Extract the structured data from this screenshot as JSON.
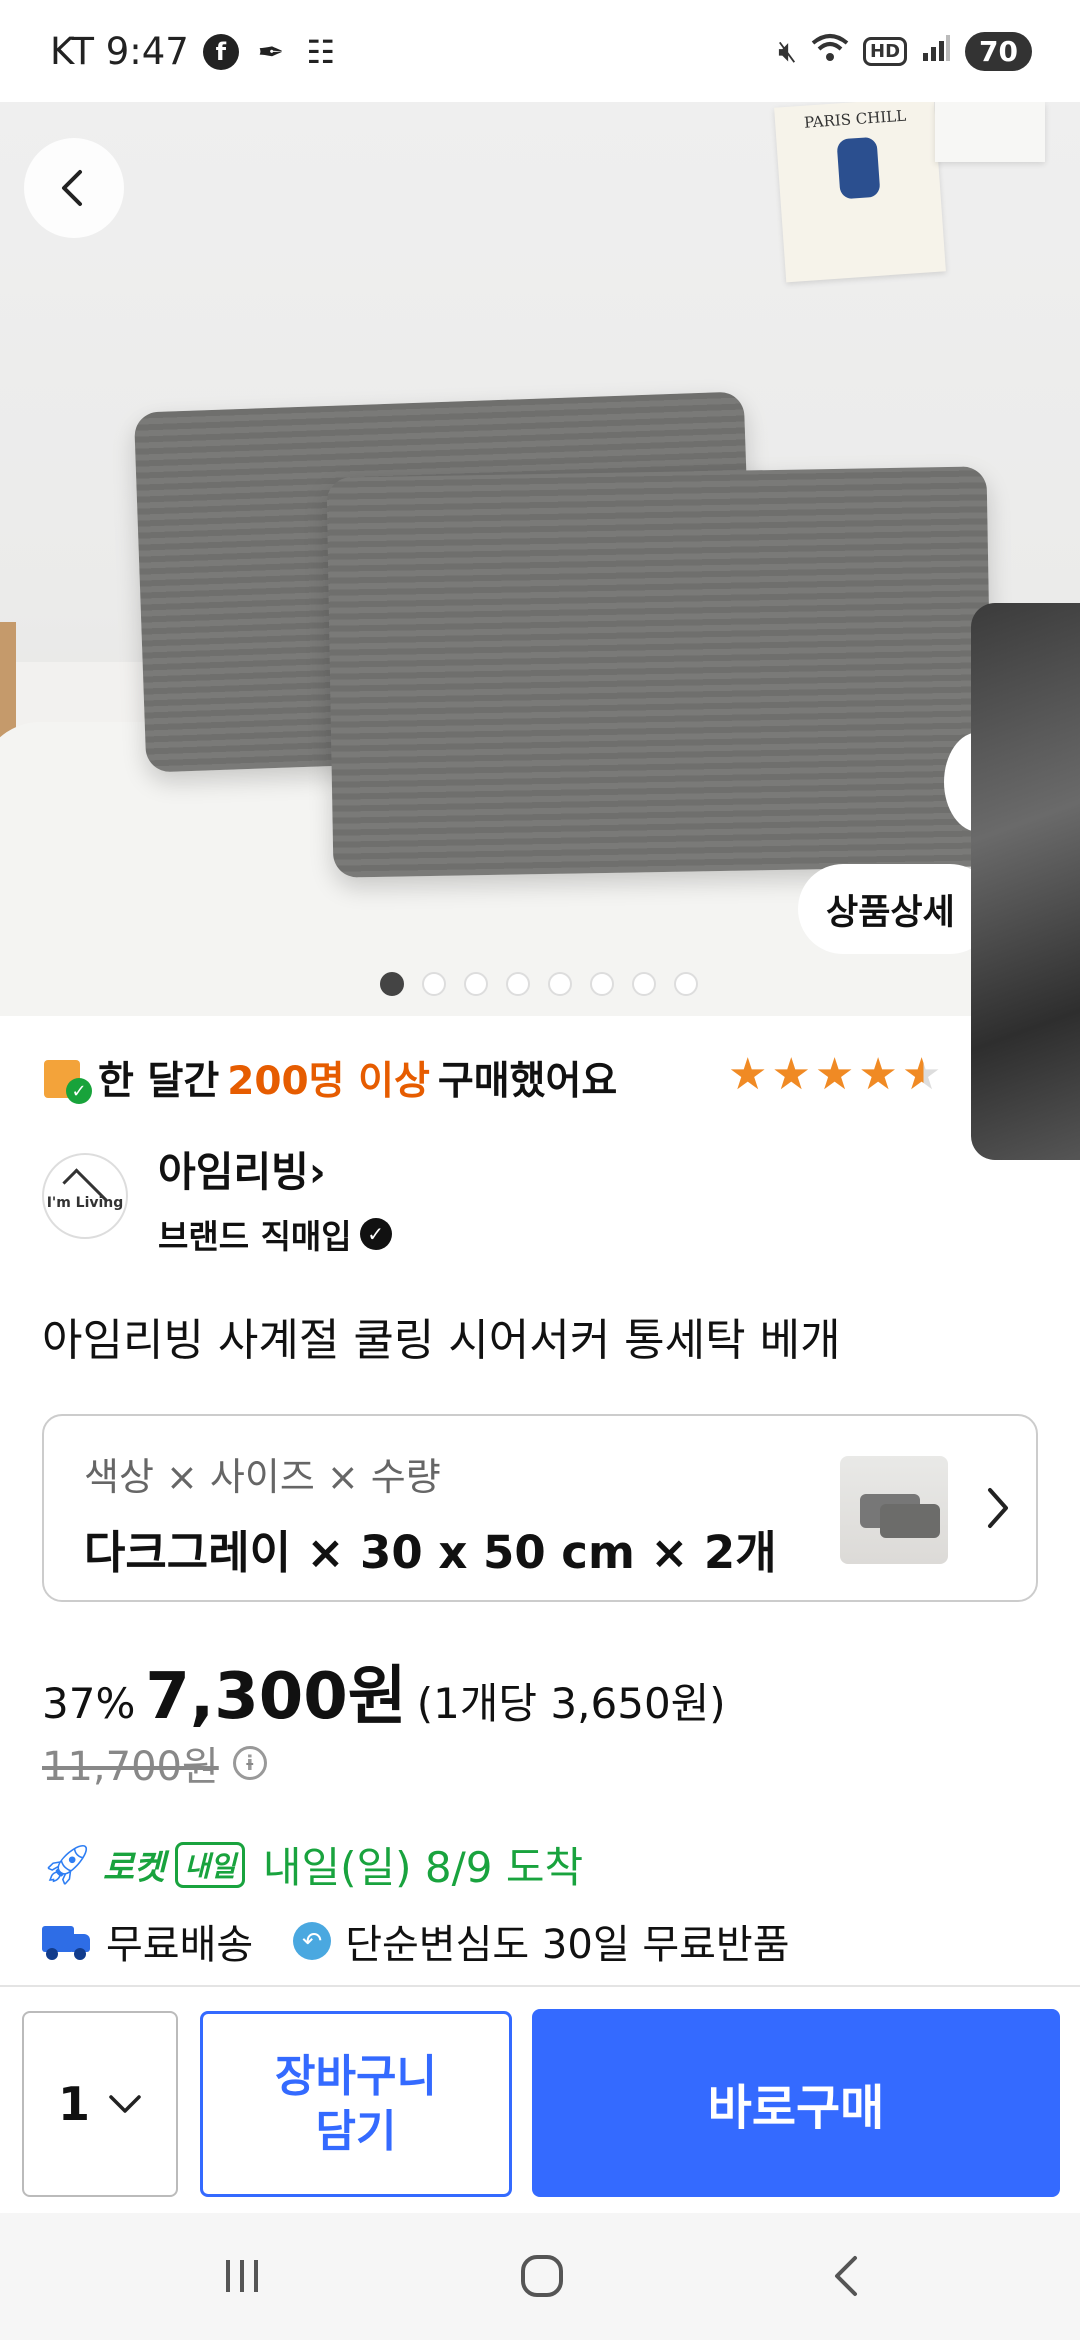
{
  "status_bar": {
    "carrier_time": "KT 9:47",
    "battery": "70",
    "hd_label": "HD",
    "wifi_num": "6"
  },
  "hero": {
    "poster_text": "PARIS CHILL",
    "detail_button": "상품상세",
    "image_count": 8,
    "active_index": 0
  },
  "social_proof": {
    "prefix": "한 달간 ",
    "highlight": "200명 이상",
    "suffix": " 구매했어요",
    "rating": 4.5
  },
  "brand": {
    "logo_text": "I'm Living",
    "name": "아임리빙›",
    "sub": "브랜드 직매입"
  },
  "product": {
    "title": "아임리빙 사계절 쿨링 시어서커 통세탁 베개"
  },
  "option": {
    "label": "색상 × 사이즈 × 수량",
    "value": "다크그레이 × 30 x 50 cm × 2개"
  },
  "price": {
    "discount": "37%",
    "sale": "7,300원",
    "unit": "(1개당 3,650원)",
    "original": "11,700원"
  },
  "delivery": {
    "rocket_label": "로켓",
    "tomorrow_badge": "내일",
    "arrival": "내일(일) 8/9 도착",
    "free_shipping": "무료배송",
    "returns": "단순변심도 30일 무료반품"
  },
  "bottom_bar": {
    "quantity": "1",
    "cart_label": "장바구니\n담기",
    "buy_label": "바로구매"
  },
  "colors": {
    "primary_blue": "#346aff",
    "orange": "#e65c00",
    "green": "#19a33e",
    "star": "#f08a24"
  }
}
